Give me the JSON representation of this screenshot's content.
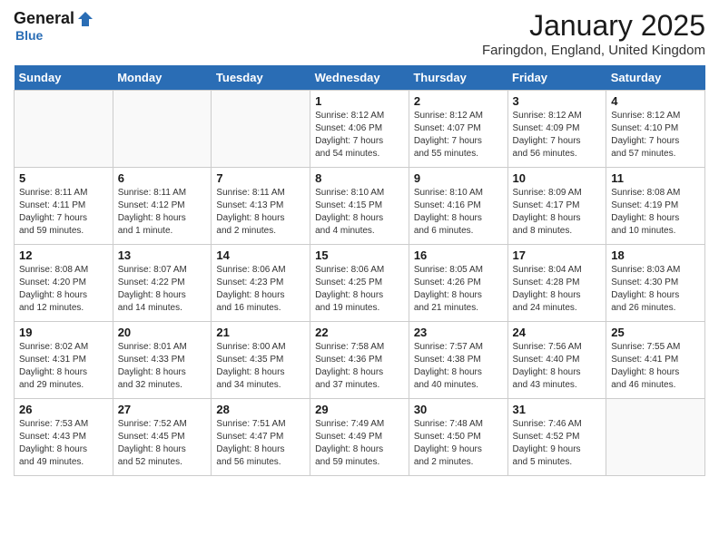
{
  "header": {
    "logo_general": "General",
    "logo_blue": "Blue",
    "month_title": "January 2025",
    "location": "Faringdon, England, United Kingdom"
  },
  "days_of_week": [
    "Sunday",
    "Monday",
    "Tuesday",
    "Wednesday",
    "Thursday",
    "Friday",
    "Saturday"
  ],
  "weeks": [
    [
      {
        "day": "",
        "info": ""
      },
      {
        "day": "",
        "info": ""
      },
      {
        "day": "",
        "info": ""
      },
      {
        "day": "1",
        "info": "Sunrise: 8:12 AM\nSunset: 4:06 PM\nDaylight: 7 hours\nand 54 minutes."
      },
      {
        "day": "2",
        "info": "Sunrise: 8:12 AM\nSunset: 4:07 PM\nDaylight: 7 hours\nand 55 minutes."
      },
      {
        "day": "3",
        "info": "Sunrise: 8:12 AM\nSunset: 4:09 PM\nDaylight: 7 hours\nand 56 minutes."
      },
      {
        "day": "4",
        "info": "Sunrise: 8:12 AM\nSunset: 4:10 PM\nDaylight: 7 hours\nand 57 minutes."
      }
    ],
    [
      {
        "day": "5",
        "info": "Sunrise: 8:11 AM\nSunset: 4:11 PM\nDaylight: 7 hours\nand 59 minutes."
      },
      {
        "day": "6",
        "info": "Sunrise: 8:11 AM\nSunset: 4:12 PM\nDaylight: 8 hours\nand 1 minute."
      },
      {
        "day": "7",
        "info": "Sunrise: 8:11 AM\nSunset: 4:13 PM\nDaylight: 8 hours\nand 2 minutes."
      },
      {
        "day": "8",
        "info": "Sunrise: 8:10 AM\nSunset: 4:15 PM\nDaylight: 8 hours\nand 4 minutes."
      },
      {
        "day": "9",
        "info": "Sunrise: 8:10 AM\nSunset: 4:16 PM\nDaylight: 8 hours\nand 6 minutes."
      },
      {
        "day": "10",
        "info": "Sunrise: 8:09 AM\nSunset: 4:17 PM\nDaylight: 8 hours\nand 8 minutes."
      },
      {
        "day": "11",
        "info": "Sunrise: 8:08 AM\nSunset: 4:19 PM\nDaylight: 8 hours\nand 10 minutes."
      }
    ],
    [
      {
        "day": "12",
        "info": "Sunrise: 8:08 AM\nSunset: 4:20 PM\nDaylight: 8 hours\nand 12 minutes."
      },
      {
        "day": "13",
        "info": "Sunrise: 8:07 AM\nSunset: 4:22 PM\nDaylight: 8 hours\nand 14 minutes."
      },
      {
        "day": "14",
        "info": "Sunrise: 8:06 AM\nSunset: 4:23 PM\nDaylight: 8 hours\nand 16 minutes."
      },
      {
        "day": "15",
        "info": "Sunrise: 8:06 AM\nSunset: 4:25 PM\nDaylight: 8 hours\nand 19 minutes."
      },
      {
        "day": "16",
        "info": "Sunrise: 8:05 AM\nSunset: 4:26 PM\nDaylight: 8 hours\nand 21 minutes."
      },
      {
        "day": "17",
        "info": "Sunrise: 8:04 AM\nSunset: 4:28 PM\nDaylight: 8 hours\nand 24 minutes."
      },
      {
        "day": "18",
        "info": "Sunrise: 8:03 AM\nSunset: 4:30 PM\nDaylight: 8 hours\nand 26 minutes."
      }
    ],
    [
      {
        "day": "19",
        "info": "Sunrise: 8:02 AM\nSunset: 4:31 PM\nDaylight: 8 hours\nand 29 minutes."
      },
      {
        "day": "20",
        "info": "Sunrise: 8:01 AM\nSunset: 4:33 PM\nDaylight: 8 hours\nand 32 minutes."
      },
      {
        "day": "21",
        "info": "Sunrise: 8:00 AM\nSunset: 4:35 PM\nDaylight: 8 hours\nand 34 minutes."
      },
      {
        "day": "22",
        "info": "Sunrise: 7:58 AM\nSunset: 4:36 PM\nDaylight: 8 hours\nand 37 minutes."
      },
      {
        "day": "23",
        "info": "Sunrise: 7:57 AM\nSunset: 4:38 PM\nDaylight: 8 hours\nand 40 minutes."
      },
      {
        "day": "24",
        "info": "Sunrise: 7:56 AM\nSunset: 4:40 PM\nDaylight: 8 hours\nand 43 minutes."
      },
      {
        "day": "25",
        "info": "Sunrise: 7:55 AM\nSunset: 4:41 PM\nDaylight: 8 hours\nand 46 minutes."
      }
    ],
    [
      {
        "day": "26",
        "info": "Sunrise: 7:53 AM\nSunset: 4:43 PM\nDaylight: 8 hours\nand 49 minutes."
      },
      {
        "day": "27",
        "info": "Sunrise: 7:52 AM\nSunset: 4:45 PM\nDaylight: 8 hours\nand 52 minutes."
      },
      {
        "day": "28",
        "info": "Sunrise: 7:51 AM\nSunset: 4:47 PM\nDaylight: 8 hours\nand 56 minutes."
      },
      {
        "day": "29",
        "info": "Sunrise: 7:49 AM\nSunset: 4:49 PM\nDaylight: 8 hours\nand 59 minutes."
      },
      {
        "day": "30",
        "info": "Sunrise: 7:48 AM\nSunset: 4:50 PM\nDaylight: 9 hours\nand 2 minutes."
      },
      {
        "day": "31",
        "info": "Sunrise: 7:46 AM\nSunset: 4:52 PM\nDaylight: 9 hours\nand 5 minutes."
      },
      {
        "day": "",
        "info": ""
      }
    ]
  ]
}
